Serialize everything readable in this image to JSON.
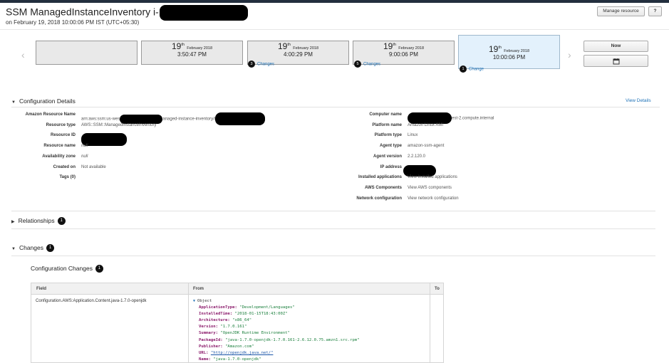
{
  "header": {
    "title": "SSM ManagedInstanceInventory i-",
    "subtitle": "on February 19, 2018 10:00:06 PM IST (UTC+05:30)",
    "manage_resource_label": "Manage resource",
    "help_label": "?"
  },
  "timeline": {
    "cards": [
      {
        "day": "",
        "sup": "",
        "month": "",
        "time": ""
      },
      {
        "day": "19",
        "sup": "th",
        "month": "February 2018",
        "time": "3:50:47 PM"
      },
      {
        "day": "19",
        "sup": "th",
        "month": "February 2018",
        "time": "4:00:29 PM",
        "change_count": "3",
        "change_label": "Changes"
      },
      {
        "day": "19",
        "sup": "th",
        "month": "February 2018",
        "time": "9:00:06 PM",
        "change_count": "5",
        "change_label": "Changes"
      },
      {
        "day": "19",
        "sup": "th",
        "month": "February 2018",
        "time": "10:00:06 PM",
        "change_count": "1",
        "change_label": "Change"
      }
    ],
    "prev_icon": "chevron-left",
    "next_icon": "chevron-right",
    "now_label": "Now",
    "calendar_icon": "calendar"
  },
  "config": {
    "heading": "Configuration Details",
    "view_details": "View Details",
    "left": [
      {
        "key": "Amazon Resource Name",
        "value_a": "arn:aws:ssm:us-wes",
        "value_b": "anaged-instance-inventory/i"
      },
      {
        "key": "Resource type",
        "value": "AWS::SSM::ManagedInstanceInventory"
      },
      {
        "key": "Resource ID",
        "value": ""
      },
      {
        "key": "Resource name",
        "value": "null"
      },
      {
        "key": "Availability zone",
        "value": "null"
      },
      {
        "key": "Created on",
        "value": "Not available"
      },
      {
        "key": "Tags (0)",
        "value": ""
      }
    ],
    "right": [
      {
        "key": "Computer name",
        "value": "est-2.compute.internal",
        "link": false
      },
      {
        "key": "Platform name",
        "value": "Amazon Linux AMI",
        "link": false
      },
      {
        "key": "Platform type",
        "value": "Linux",
        "link": false
      },
      {
        "key": "Agent type",
        "value": "amazon-ssm-agent",
        "link": false
      },
      {
        "key": "Agent version",
        "value": "2.2.120.0",
        "link": false
      },
      {
        "key": "IP address",
        "value": "",
        "link": false
      },
      {
        "key": "Installed applications",
        "value": "View installed applications",
        "link": true
      },
      {
        "key": "AWS Components",
        "value": "View AWS components",
        "link": true
      },
      {
        "key": "Network configuration",
        "value": "View network configuration",
        "link": true
      }
    ]
  },
  "relationships": {
    "heading": "Relationships",
    "count": "1"
  },
  "changes": {
    "heading": "Changes",
    "count": "1",
    "sub_heading": "Configuration Changes",
    "sub_count": "1",
    "columns": [
      "Field",
      "From",
      "To"
    ],
    "row": {
      "field": "Configuration.AWS:Application.Content.java-1.7.0-openjdk",
      "object_label": "Object",
      "lines": [
        {
          "key": "ApplicationType:",
          "value": "\"Development/Languages\""
        },
        {
          "key": "InstalledTime:",
          "value": "\"2018-01-15T18:43:00Z\""
        },
        {
          "key": "Architecture:",
          "value": "\"x86_64\""
        },
        {
          "key": "Version:",
          "value": "\"1.7.0.161\""
        },
        {
          "key": "Summary:",
          "value": "\"OpenJDK Runtime Environment\""
        },
        {
          "key": "PackageId:",
          "value": "\"java-1.7.0-openjdk-1.7.0.161-2.6.12.0.75.amzn1.src.rpm\""
        },
        {
          "key": "Publisher:",
          "value": "\"Amazon.com\""
        },
        {
          "key": "URL:",
          "value": "\"http://openjdk.java.net/\"",
          "url": true
        },
        {
          "key": "Name:",
          "value": "\"java-1.7.0-openjdk\""
        }
      ]
    }
  },
  "colors": {
    "link": "#2073b8",
    "selected_card": "#e3f1fc",
    "badge": "#111111",
    "topbar": "#232f3e"
  }
}
